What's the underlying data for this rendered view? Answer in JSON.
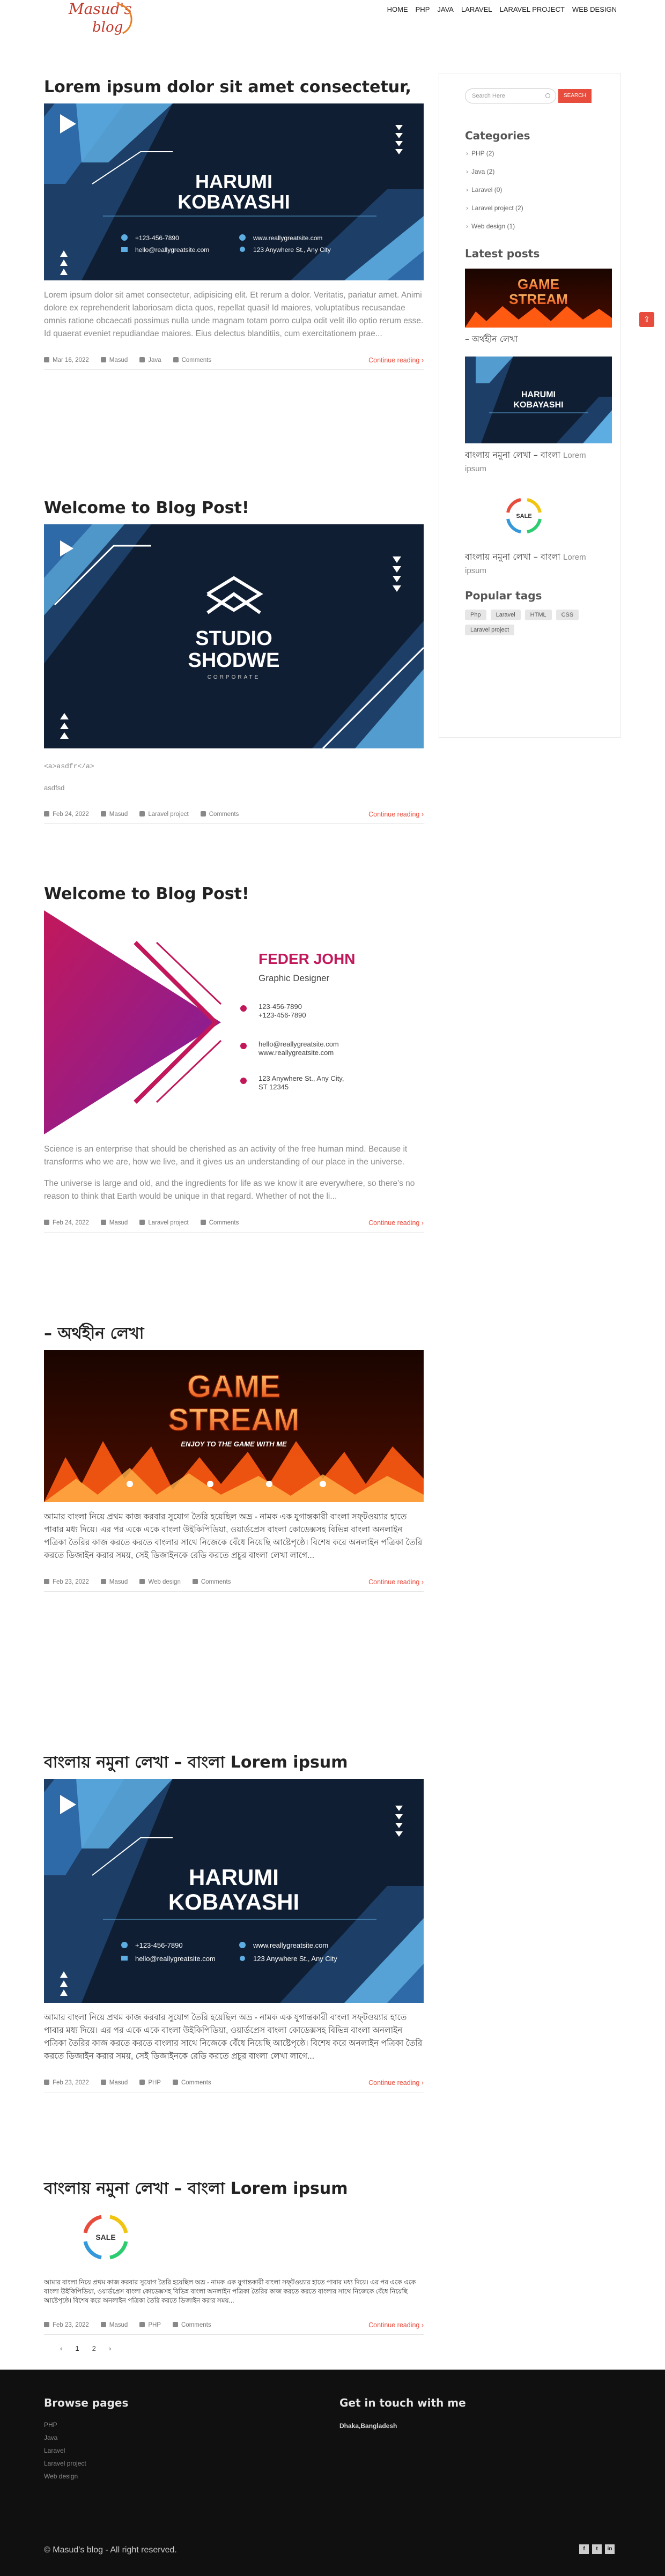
{
  "site": {
    "logo_line1": "Masud's",
    "logo_line2": "blog",
    "nav": [
      "HOME",
      "PHP",
      "JAVA",
      "LARAVEL",
      "LARAVEL PROJECT",
      "WEB DESIGN"
    ]
  },
  "colors": {
    "accent": "#e74c3c",
    "navy": "#0f1e33",
    "light_blue": "#5dade2",
    "footer_bg": "#101010"
  },
  "posts": [
    {
      "title": "Lorem ipsum dolor sit amet consectetur,",
      "image": "harumi-card",
      "excerpt": "Lorem ipsum dolor sit amet consectetur, adipisicing elit. Et rerum a dolor. Veritatis, pariatur amet. Animi dolore ex reprehenderit laboriosam dicta quos, repellat quasi! Id maiores, voluptatibus recusandae omnis ratione obcaecati possimus nulla unde magnam totam porro culpa odit velit illo optio rerum esse. Id quaerat eveniet repudiandae maiores. Eius delectus blanditiis, cum exercitationem prae...",
      "date": "Mar 16, 2022",
      "author": "Masud",
      "category": "Java",
      "comments": "Comments",
      "continue": "Continue reading ›"
    },
    {
      "title": "Welcome to Blog Post!",
      "image": "studio-card",
      "excerpt_lines": [
        "<a>asdfr</a>",
        "asdfsd"
      ],
      "date": "Feb 24, 2022",
      "author": "Masud",
      "category": "Laravel project",
      "comments": "Comments",
      "continue": "Continue reading ›"
    },
    {
      "title": "Welcome to Blog Post!",
      "image": "feder-card",
      "excerpt_p1": "Science is an enterprise that should be cherished as an activity of the free human mind. Because it transforms who we are, how we live, and it gives us an understanding of our place in the universe.",
      "excerpt_p2": "The universe is large and old, and the ingredients for life as we know it are everywhere, so there's no reason to think that Earth would be unique in that regard. Whether of not the li...",
      "date": "Feb 24, 2022",
      "author": "Masud",
      "category": "Laravel project",
      "comments": "Comments",
      "continue": "Continue reading ›"
    },
    {
      "title": "– অর্থহীন লেখা",
      "image": "game-stream",
      "excerpt": "আমার বাংলা নিয়ে প্রথম কাজ করবার সুযোগ তৈরি হয়েছিল অভ্র - নামক এক যুগান্তকারী বাংলা সফ্‌টওয়্যার হাতে পাবার মধ্য দিয়ে। এর পর একে একে বাংলা উইকিপিডিয়া, ওয়ার্ডপ্রেস বাংলা কোডেক্সসহ বিভিন্ন বাংলা অনলাইন পত্রিকা তৈরির কাজ করতে করতে বাংলার সাথে নিজেকে বেঁধে নিয়েছি আষ্টেপৃষ্ঠে। বিশেষ করে অনলাইন পত্রিকা তৈরি করতে ডিজাইন করার সময়, সেই ডিজাইনকে রেডি করতে প্রচুর বাংলা লেখা লাগে...",
      "date": "Feb 23, 2022",
      "author": "Masud",
      "category": "Web design",
      "comments": "Comments",
      "continue": "Continue reading ›"
    },
    {
      "title": "বাংলায় নমুনা লেখা – বাংলা Lorem ipsum",
      "image": "harumi-card",
      "excerpt": "আমার বাংলা নিয়ে প্রথম কাজ করবার সুযোগ তৈরি হয়েছিল অভ্র - নামক এক যুগান্তকারী বাংলা সফ্‌টওয়্যার হাতে পাবার মধ্য দিয়ে। এর পর একে একে বাংলা উইকিপিডিয়া, ওয়ার্ডপ্রেস বাংলা কোডেক্সসহ বিভিন্ন বাংলা অনলাইন পত্রিকা তৈরির কাজ করতে করতে বাংলার সাথে নিজেকে বেঁধে নিয়েছি আষ্টেপৃষ্ঠে। বিশেষ করে অনলাইন পত্রিকা তৈরি করতে ডিজাইন করার সময়, সেই ডিজাইনকে রেডি করতে প্রচুর বাংলা লেখা লাগে...",
      "date": "Feb 23, 2022",
      "author": "Masud",
      "category": "PHP",
      "comments": "Comments",
      "continue": "Continue reading ›"
    },
    {
      "title": "বাংলায় নমুনা লেখা – বাংলা Lorem ipsum",
      "image": "sale-logo",
      "excerpt": "আমার বাংলা নিয়ে প্রথম কাজ করবার সুযোগ তৈরি হয়েছিল অভ্র - নামক এক যুগান্তকারী বাংলা সফ্‌টওয়্যার হাতে পাবার মধ্য দিয়ে। এর পর একে একে বাংলা উইকিপিডিয়া, ওয়ার্ডপ্রেস বাংলা কোডেক্সসহ বিভিন্ন বাংলা অনলাইন পত্রিকা তৈরির কাজ করতে করতে বাংলার সাথে নিজেকে বেঁধে নিয়েছি আষ্টেপৃষ্ঠে। বিশেষ করে অনলাইন পত্রিকা তৈরি করতে ডিজাইন করার সময়...",
      "date": "Feb 23, 2022",
      "author": "Masud",
      "category": "PHP",
      "comments": "Comments",
      "continue": "Continue reading ›"
    }
  ],
  "cards": {
    "harumi_name1": "HARUMI",
    "harumi_name2": "KOBAYASHI",
    "harumi_phone": "+123-456-7890",
    "harumi_email": "hello@reallygreatsite.com",
    "harumi_web": "www.reallygreatsite.com",
    "harumi_addr": "123 Anywhere St., Any City",
    "studio1": "STUDIO",
    "studio2": "SHODWE",
    "studio3": "CORPORATE",
    "feder_name": "FEDER JOHN",
    "feder_role": "Graphic Designer",
    "feder_phone1": "123-456-7890",
    "feder_phone2": "+123-456-7890",
    "feder_mail1": "hello@reallygreatsite.com",
    "feder_mail2": "www.reallygreatsite.com",
    "feder_addr1": "123 Anywhere St., Any City,",
    "feder_addr2": "ST 12345",
    "game1": "GAME",
    "game2": "STREAM",
    "game3": "ENJOY TO THE GAME WITH ME",
    "sale": "SALE"
  },
  "sidebar": {
    "search_placeholder": "Search Here",
    "search_button": "SEARCH",
    "categories_title": "Categories",
    "categories": [
      "PHP (2)",
      "Java (2)",
      "Laravel (0)",
      "Laravel project (2)",
      "Web design (1)"
    ],
    "latest_title": "Latest posts",
    "latest": [
      {
        "image": "game-stream",
        "title": "– অর্থহীন লেখা",
        "extra": ""
      },
      {
        "image": "harumi-card",
        "title": "বাংলায় নমুনা লেখা – বাংলা",
        "extra": "Lorem ipsum"
      },
      {
        "image": "sale-logo",
        "title": "বাংলায় নমুনা লেখা – বাংলা",
        "extra": "Lorem ipsum"
      }
    ],
    "tags_title": "Popular tags",
    "tags": [
      "Php",
      "Laravel",
      "HTML",
      "CSS",
      "Laravel project"
    ]
  },
  "pagination": {
    "prev": "‹",
    "pages": [
      "1",
      "2"
    ],
    "next": "›"
  },
  "footer": {
    "browse_title": "Browse pages",
    "browse": [
      "PHP",
      "Java",
      "Laravel",
      "Laravel project",
      "Web design"
    ],
    "contact_title": "Get in touch with me",
    "address": "Dhaka,Bangladesh",
    "copyright": "© Masud's blog - All right reserved.",
    "social": [
      "f",
      "t",
      "in"
    ]
  }
}
